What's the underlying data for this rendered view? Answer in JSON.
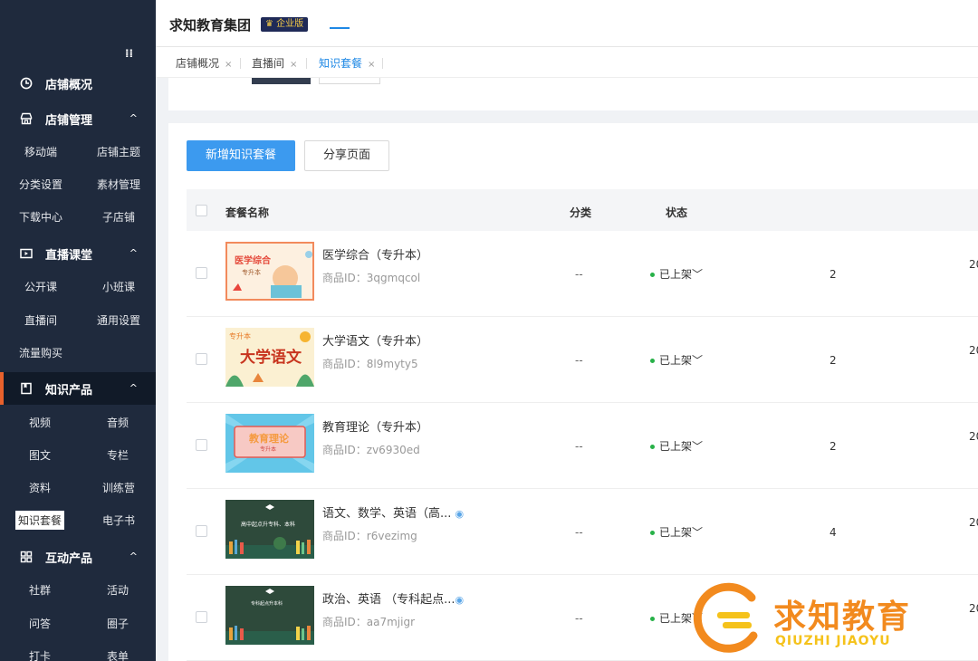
{
  "sidebar": {
    "collapse_glyph": "⁞⁞",
    "groups": [
      {
        "label": "店铺概况",
        "icon": "clock-icon"
      },
      {
        "label": "店铺管理",
        "icon": "store-icon",
        "chevron": "^"
      },
      {
        "label": "直播课堂",
        "icon": "video-icon",
        "chevron": "^"
      },
      {
        "label": "知识产品",
        "icon": "book-icon",
        "chevron": "^"
      },
      {
        "label": "互动产品",
        "icon": "grid-icon",
        "chevron": "^"
      }
    ],
    "items": {
      "mobile": "移动端",
      "theme": "店铺主题",
      "category": "分类设置",
      "material": "素材管理",
      "download": "下载中心",
      "substore": "子店铺",
      "open_course": "公开课",
      "small_class": "小班课",
      "live_room": "直播间",
      "general": "通用设置",
      "traffic": "流量购买",
      "video": "视频",
      "audio": "音频",
      "article": "图文",
      "column": "专栏",
      "resource": "资料",
      "camp": "训练营",
      "package": "知识套餐",
      "ebook": "电子书",
      "community": "社群",
      "activity": "活动",
      "qa": "问答",
      "circle": "圈子",
      "checkin": "打卡",
      "form": "表单"
    }
  },
  "header": {
    "brand": "求知教育集团",
    "badge": "♛ 企业版"
  },
  "tabs": [
    {
      "label": "店铺概况",
      "close": "×"
    },
    {
      "label": "直播间",
      "close": "×"
    },
    {
      "label": "知识套餐",
      "close": "×"
    }
  ],
  "toolbar": {
    "add_label": "新增知识套餐",
    "share_label": "分享页面"
  },
  "table": {
    "headers": {
      "name": "套餐名称",
      "category": "分类",
      "status": "状态"
    },
    "rows": [
      {
        "name": "医学综合（专升本）",
        "pid": "商品ID：3qgmqcol",
        "category": "--",
        "status": "已上架",
        "count": "2",
        "date": "20"
      },
      {
        "name": "大学语文（专升本）",
        "pid": "商品ID：8l9myty5",
        "category": "--",
        "status": "已上架",
        "count": "2",
        "date": "20"
      },
      {
        "name": "教育理论（专升本）",
        "pid": "商品ID：zv6930ed",
        "category": "--",
        "status": "已上架",
        "count": "2",
        "date": "20"
      },
      {
        "name": "语文、数学、英语（高...",
        "pid": "商品ID：r6vezimg",
        "category": "--",
        "status": "已上架",
        "count": "4",
        "date": "20"
      },
      {
        "name": "政治、英语 （专科起点...",
        "pid": "商品ID：aa7mjigr",
        "category": "--",
        "status": "已上架",
        "count": "",
        "date": "20"
      }
    ],
    "status_caret": "﹀"
  },
  "thumbs": {
    "t1_title": "医学综合",
    "t1_sub": "专升本",
    "t2_tag": "专升本",
    "t2_title": "大学语文",
    "t3_title": "教育理论",
    "t3_sub": "专升本",
    "t4_title": "高中起点升专科、本科",
    "t5_title": "专科起点升本科"
  },
  "watermark": {
    "title": "求知教育",
    "sub": "QIUZHI JIAOYU"
  },
  "colors": {
    "sidebar_bg": "#1f2a3d",
    "accent_blue": "#3c9aef",
    "active_orange": "#e8612c",
    "status_green": "#27b148",
    "logo_orange": "#f28a1e"
  }
}
